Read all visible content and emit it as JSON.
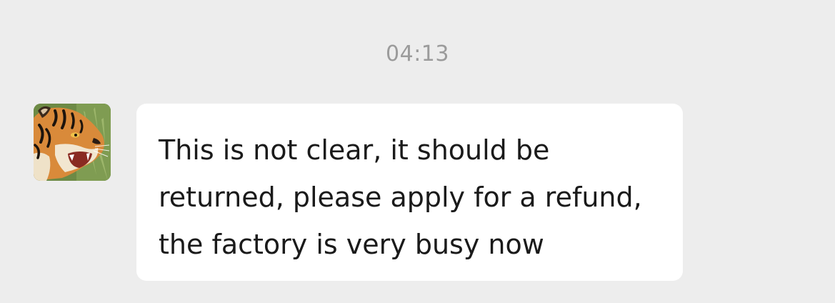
{
  "chat": {
    "timestamp": "04:13",
    "message": {
      "sender_avatar": "tiger-avatar",
      "text": "This is not clear, it should be returned, please apply for a refund, the factory is very busy now"
    }
  },
  "colors": {
    "background": "#ededed",
    "bubble": "#ffffff",
    "timestamp_text": "#9b9b9b",
    "message_text": "#1a1a1a"
  }
}
